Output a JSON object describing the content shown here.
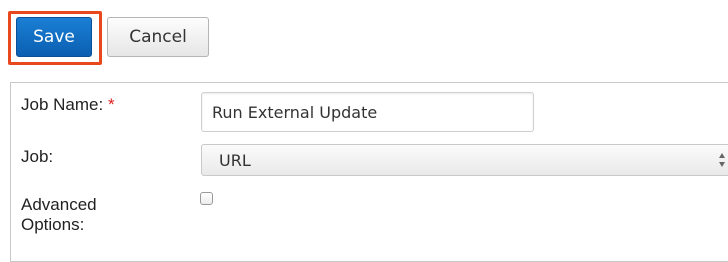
{
  "toolbar": {
    "save_label": "Save",
    "cancel_label": "Cancel",
    "highlight_color": "#e8481c"
  },
  "form": {
    "job_name": {
      "label": "Job Name:",
      "required_marker": "*",
      "value": "Run External Update"
    },
    "job": {
      "label": "Job:",
      "selected": "URL"
    },
    "advanced_options": {
      "label_line1": "Advanced",
      "label_line2": "Options:",
      "checked": false
    }
  },
  "colors": {
    "primary_button": "#0b5fb2",
    "required": "#e02020"
  }
}
